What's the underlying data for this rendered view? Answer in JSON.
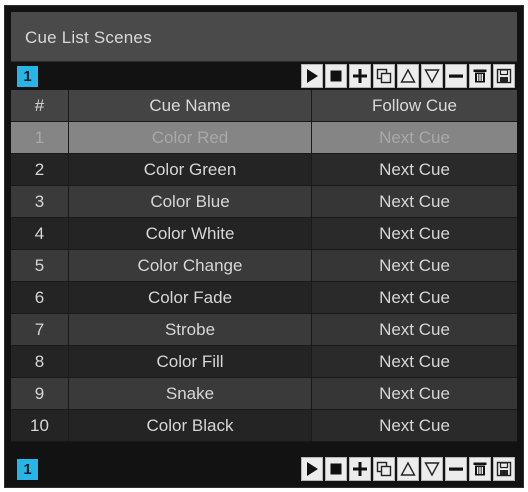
{
  "panel": {
    "title": "Cue List Scenes"
  },
  "toolbar": {
    "page": "1",
    "tools": [
      {
        "name": "play-button",
        "icon": "play-icon"
      },
      {
        "name": "stop-button",
        "icon": "stop-icon"
      },
      {
        "name": "add-cue-button",
        "icon": "plus-icon"
      },
      {
        "name": "copy-cue-button",
        "icon": "copy-icon"
      },
      {
        "name": "move-up-button",
        "icon": "triangle-up-icon"
      },
      {
        "name": "move-down-button",
        "icon": "triangle-down-icon"
      },
      {
        "name": "remove-cue-button",
        "icon": "minus-icon"
      },
      {
        "name": "delete-cue-button",
        "icon": "trash-icon"
      },
      {
        "name": "save-button",
        "icon": "floppy-icon"
      }
    ]
  },
  "table": {
    "columns": [
      "#",
      "Cue Name",
      "Follow Cue"
    ],
    "selected_row": 0,
    "rows": [
      {
        "num": "1",
        "name": "Color Red",
        "follow": "Next Cue"
      },
      {
        "num": "2",
        "name": "Color Green",
        "follow": "Next Cue"
      },
      {
        "num": "3",
        "name": "Color Blue",
        "follow": "Next Cue"
      },
      {
        "num": "4",
        "name": "Color White",
        "follow": "Next Cue"
      },
      {
        "num": "5",
        "name": "Color Change",
        "follow": "Next Cue"
      },
      {
        "num": "6",
        "name": "Color Fade",
        "follow": "Next Cue"
      },
      {
        "num": "7",
        "name": "Strobe",
        "follow": "Next Cue"
      },
      {
        "num": "8",
        "name": "Color Fill",
        "follow": "Next Cue"
      },
      {
        "num": "9",
        "name": "Snake",
        "follow": "Next Cue"
      },
      {
        "num": "10",
        "name": "Color Black",
        "follow": "Next Cue"
      }
    ]
  },
  "colors": {
    "accent": "#27b4e6",
    "selected_row": "#858585"
  }
}
